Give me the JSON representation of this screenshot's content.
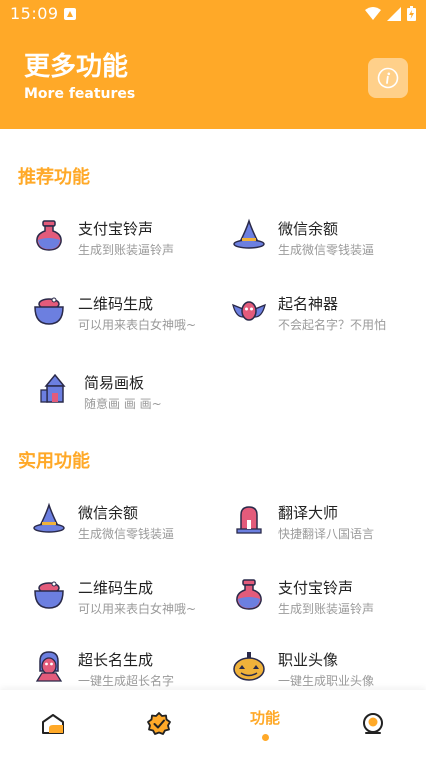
{
  "status": {
    "time": "15:09"
  },
  "header": {
    "title": "更多功能",
    "subtitle": "More features"
  },
  "recommended": {
    "title": "推荐功能",
    "items": [
      {
        "label": "支付宝铃声",
        "desc": "生成到账装逼铃声",
        "icon": "potion-icon"
      },
      {
        "label": "微信余额",
        "desc": "生成微信零钱装逼",
        "icon": "witch-hat-icon"
      },
      {
        "label": "二维码生成",
        "desc": "可以用来表白女神哦~",
        "icon": "cauldron-icon"
      },
      {
        "label": "起名神器",
        "desc": "不会起名字？不用怕",
        "icon": "bat-icon"
      },
      {
        "label": "简易画板",
        "desc": "随意画 画 画~",
        "icon": "haunted-house-icon"
      }
    ]
  },
  "practical": {
    "title": "实用功能",
    "items": [
      {
        "label": "微信余额",
        "desc": "生成微信零钱装逼",
        "icon": "witch-hat-icon"
      },
      {
        "label": "翻译大师",
        "desc": "快捷翻译八国语言",
        "icon": "tombstone-icon"
      },
      {
        "label": "二维码生成",
        "desc": "可以用来表白女神哦~",
        "icon": "cauldron-icon"
      },
      {
        "label": "支付宝铃声",
        "desc": "生成到账装逼铃声",
        "icon": "potion-icon"
      },
      {
        "label": "超长名生成",
        "desc": "一键生成超长名字",
        "icon": "vampire-icon"
      },
      {
        "label": "职业头像",
        "desc": "一键生成职业头像",
        "icon": "pumpkin-icon"
      }
    ]
  },
  "nav": {
    "active_label": "功能"
  },
  "colors": {
    "accent": "#FFA928",
    "text": "#222222",
    "muted": "#9A9A9A"
  }
}
